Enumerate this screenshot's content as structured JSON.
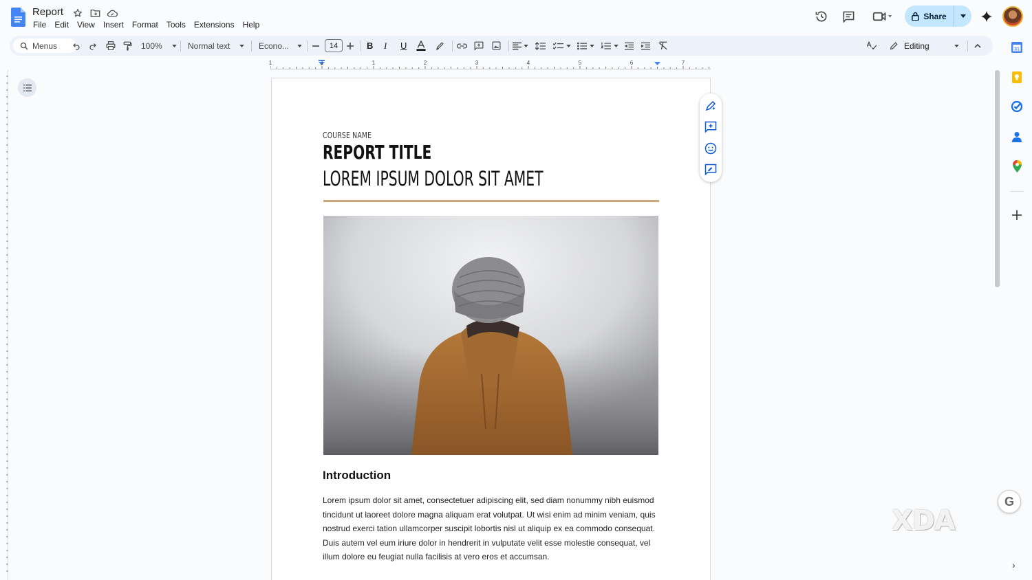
{
  "doc": {
    "title": "Report"
  },
  "menus": [
    "File",
    "Edit",
    "View",
    "Insert",
    "Format",
    "Tools",
    "Extensions",
    "Help"
  ],
  "header": {
    "share_label": "Share"
  },
  "toolbar": {
    "search_label": "Menus",
    "zoom": "100%",
    "style": "Normal text",
    "font": "Econo...",
    "font_size": "14",
    "mode": "Editing"
  },
  "ruler": {
    "numbers": [
      "1",
      "1",
      "1",
      "2",
      "3",
      "4",
      "5",
      "6",
      "7"
    ]
  },
  "document": {
    "course_name": "COURSE NAME",
    "report_title": "REPORT TITLE",
    "subtitle": "LOREM IPSUM DOLOR SIT AMET",
    "intro_heading": "Introduction",
    "intro_body": "Lorem ipsum dolor sit amet, consectetuer adipiscing elit, sed diam nonummy nibh euismod tincidunt ut laoreet dolore magna aliquam erat volutpat. Ut wisi enim ad minim veniam, quis nostrud exerci tation ullamcorper suscipit lobortis nisl ut aliquip ex ea commodo consequat. Duis autem vel eum iriure dolor in hendrerit in vulputate velit esse molestie consequat, vel illum dolore eu feugiat nulla facilisis at vero eros et accumsan."
  },
  "watermark": {
    "text": "XDA"
  },
  "grammarly": {
    "letter": "G"
  },
  "colors": {
    "accent": "#0b57d0",
    "share_bg": "#c2e7ff",
    "rule": "#c9a77a"
  }
}
